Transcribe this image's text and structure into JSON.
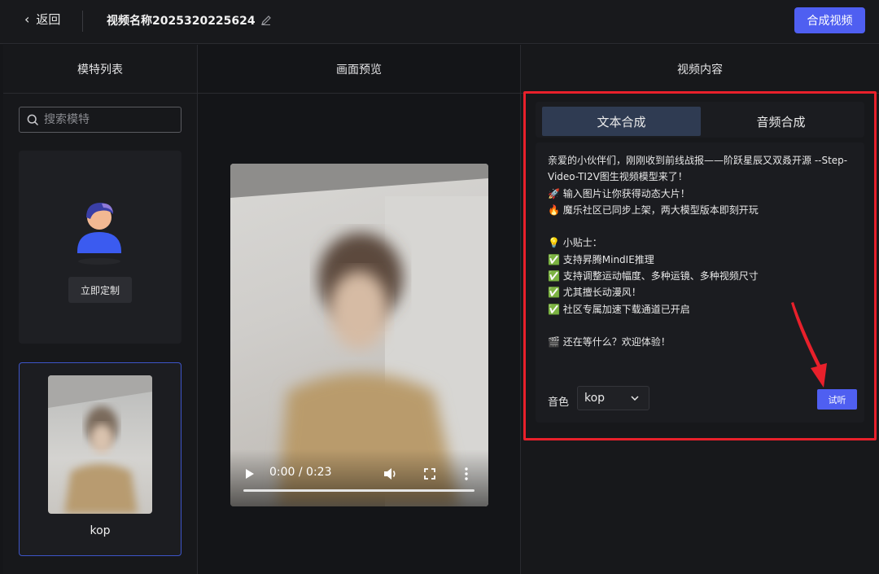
{
  "header": {
    "back_label": "返回",
    "video_title": "视频名称2025320225624",
    "compose_button": "合成视频"
  },
  "columns": {
    "models": "模特列表",
    "preview": "画面预览",
    "content": "视频内容"
  },
  "models_panel": {
    "search_placeholder": "搜索模特",
    "custom_button": "立即定制",
    "selected_model_name": "kop"
  },
  "video_player": {
    "time": "0:00 / 0:23",
    "progress_fraction": 0.0
  },
  "content_panel": {
    "tabs": [
      "文本合成",
      "音频合成"
    ],
    "active_tab": "文本合成",
    "text": "亲爱的小伙伴们，刚刚收到前线战报——阶跃星辰又双叒开源 --Step-Video-TI2V图生视频模型来了！\n🚀 输入图片让你获得动态大片！\n🔥 魔乐社区已同步上架，两大模型版本即刻开玩\n\n💡 小贴士：\n✅ 支持昇腾MindIE推理\n✅ 支持调整运动幅度、多种运镜、多种视频尺寸\n✅ 尤其擅长动漫风！\n✅ 社区专属加速下载通道已开启\n\n🎬 还在等什么？欢迎体验！",
    "voice_label": "音色",
    "voice_value": "kop",
    "listen_button": "试听"
  },
  "colors": {
    "accent": "#4f5ff1",
    "highlight_border": "#e8202b",
    "active_tab": "#2f3b52"
  }
}
